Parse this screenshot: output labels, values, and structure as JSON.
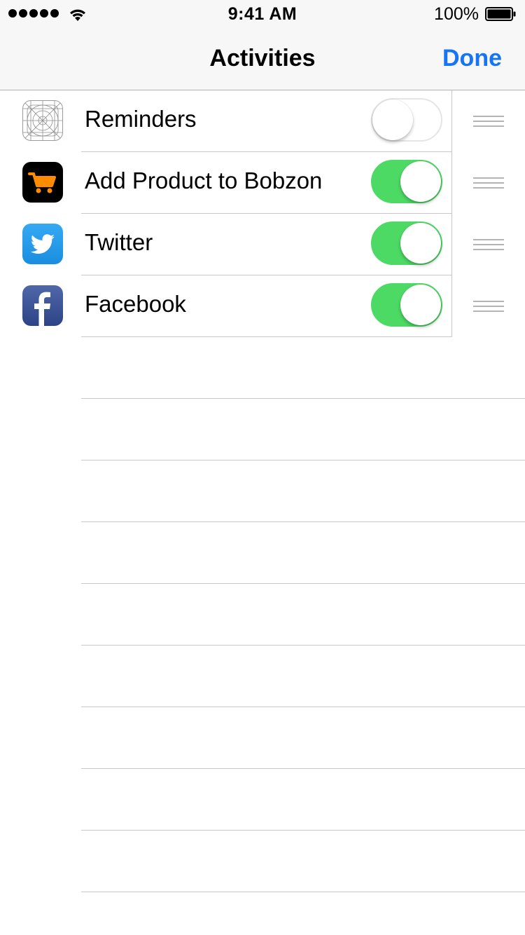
{
  "status_bar": {
    "time": "9:41 AM",
    "battery_percent": "100%",
    "signal_icon": "signal-dots-icon",
    "wifi_icon": "wifi-icon",
    "battery_icon": "battery-icon"
  },
  "nav": {
    "title": "Activities",
    "done_label": "Done",
    "done_color": "#1575f5"
  },
  "activities": [
    {
      "label": "Reminders",
      "icon": "reminders-placeholder-icon",
      "enabled": false
    },
    {
      "label": "Add Product to Bobzon",
      "icon": "shopping-cart-icon",
      "enabled": true
    },
    {
      "label": "Twitter",
      "icon": "twitter-bird-icon",
      "enabled": true
    },
    {
      "label": "Facebook",
      "icon": "facebook-f-icon",
      "enabled": true
    }
  ],
  "colors": {
    "toggle_on": "#4cd964",
    "bobzon_bg": "#000000",
    "bobzon_cart": "#ff8c00",
    "twitter_bg": "#1da1f2",
    "facebook_bg": "#3b5998"
  }
}
